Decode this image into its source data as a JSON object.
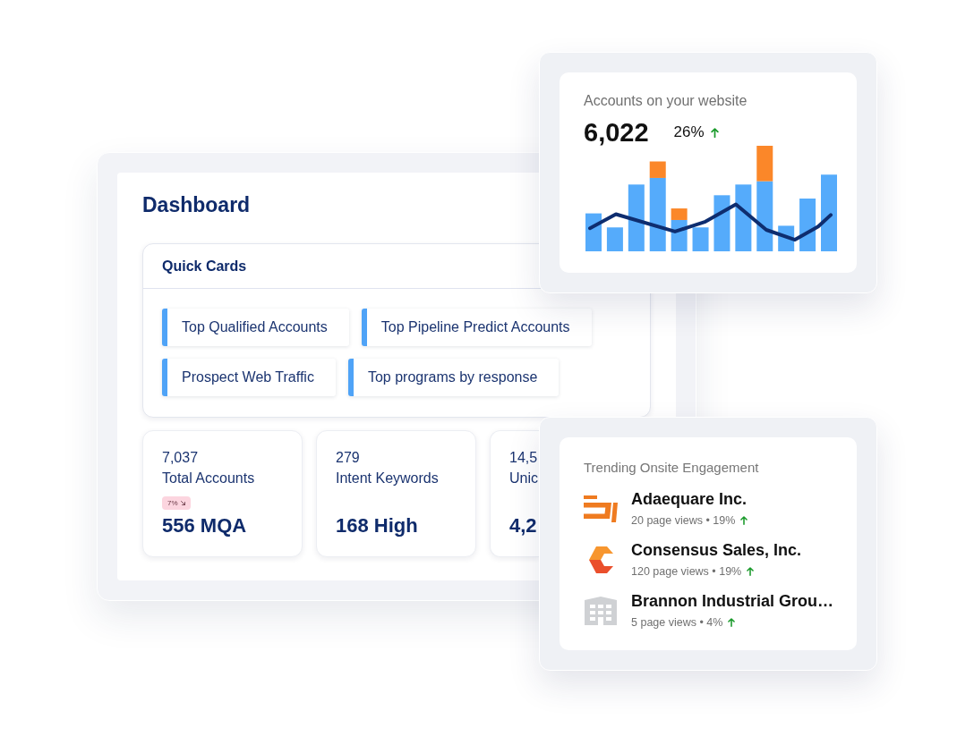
{
  "dashboard": {
    "title": "Dashboard",
    "quick_cards": {
      "title": "Quick Cards",
      "items": [
        "Top Qualified Accounts",
        "Top Pipeline Predict Accounts",
        "Prospect Web Traffic",
        "Top programs by response"
      ]
    },
    "stat_cards": [
      {
        "count": "7,037",
        "label": "Total Accounts",
        "badge": {
          "text": "7%",
          "rising": false
        },
        "value": "556 MQA"
      },
      {
        "count": "279",
        "label": "Intent Keywords",
        "value": "168 High"
      },
      {
        "count": "14,5",
        "label": "Unic",
        "value": "4,2"
      }
    ]
  },
  "website_accounts": {
    "title": "Accounts on your website",
    "total": "6,022",
    "change": "26%",
    "rising": true
  },
  "trending": {
    "title": "Trending Onsite Engagement",
    "companies": [
      {
        "kind": "bracket",
        "name": "Adaequare Inc.",
        "stats": "20 page views • 19%",
        "rising": true
      },
      {
        "kind": "hexagon",
        "name": "Consensus Sales, Inc.",
        "stats": "120 page views • 19%",
        "rising": true
      },
      {
        "kind": "building",
        "name": "Brannon Industrial Grou…",
        "stats": "5 page views • 4%",
        "rising": true
      }
    ]
  }
}
